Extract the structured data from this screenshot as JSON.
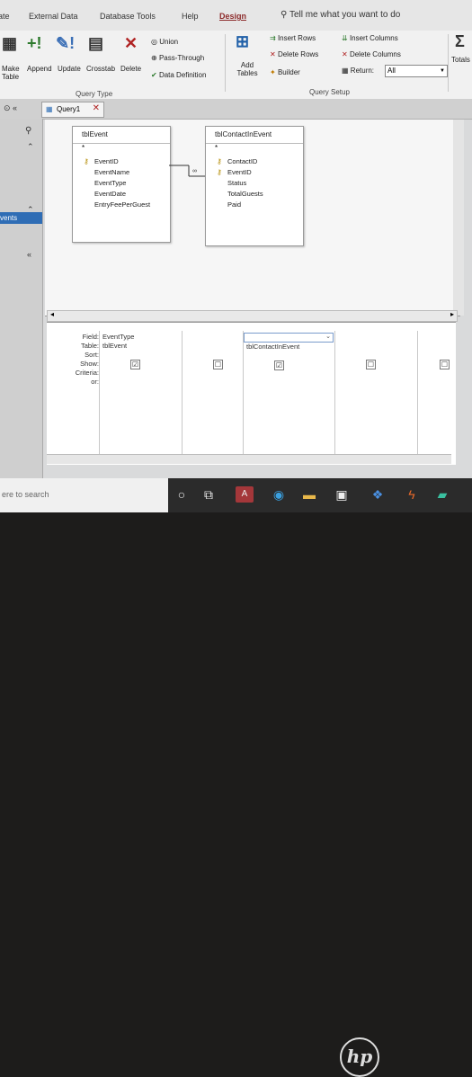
{
  "menu": {
    "tabs": [
      "ate",
      "External Data",
      "Database Tools",
      "Help",
      "Design"
    ],
    "tell_me": "Tell me what you want to do"
  },
  "ribbon": {
    "query_type": {
      "buttons": [
        "Make Table",
        "Append",
        "Update",
        "Crosstab",
        "Delete"
      ],
      "union": "Union",
      "pass_through": "Pass-Through",
      "data_definition": "Data Definition",
      "label": "Query Type"
    },
    "query_setup": {
      "add_tables": "Add Tables",
      "insert_rows": "Insert Rows",
      "delete_rows": "Delete Rows",
      "builder": "Builder",
      "insert_columns": "Insert Columns",
      "delete_columns": "Delete Columns",
      "return_label": "Return:",
      "return_value": "All",
      "label": "Query Setup"
    },
    "totals": "Totals"
  },
  "document_tab": "Query1",
  "nav_pane": {
    "selected": "vents"
  },
  "tables": [
    {
      "title": "tblEvent",
      "fields": [
        "EventID",
        "EventName",
        "EventType",
        "EventDate",
        "EntryFeePerGuest"
      ],
      "keys": [
        true,
        false,
        false,
        false,
        false
      ]
    },
    {
      "title": "tblContactInEvent",
      "fields": [
        "ContactID",
        "EventID",
        "Status",
        "TotalGuests",
        "Paid"
      ],
      "keys": [
        true,
        true,
        false,
        false,
        false
      ]
    }
  ],
  "grid": {
    "row_labels": [
      "Field:",
      "Table:",
      "Sort:",
      "Show:",
      "Criteria:",
      "or:"
    ],
    "columns": [
      {
        "field": "EventType",
        "table": "tblEvent",
        "show": "☑"
      },
      {
        "field": "",
        "table": "",
        "show": "☐"
      },
      {
        "field": "",
        "table": "tblContactInEvent",
        "show": "☑"
      },
      {
        "field": "",
        "table": "",
        "show": "☐"
      },
      {
        "field": "",
        "table": "",
        "show": "☐"
      }
    ]
  },
  "taskbar": {
    "search_placeholder": "ere to search"
  },
  "brand": "hp"
}
